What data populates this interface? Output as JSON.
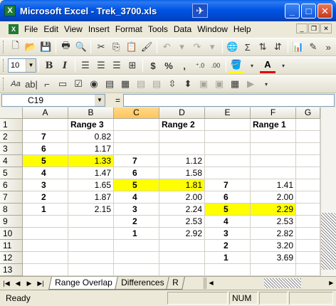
{
  "window": {
    "title": "Microsoft Excel - Trek_3700.xls",
    "app_icon": "X"
  },
  "menu": [
    "File",
    "Edit",
    "View",
    "Insert",
    "Format",
    "Tools",
    "Data",
    "Window",
    "Help"
  ],
  "toolbar": {
    "font_size": "10"
  },
  "formula_bar": {
    "name_box": "C19",
    "fx_label": "="
  },
  "grid": {
    "columns": [
      "A",
      "B",
      "C",
      "D",
      "E",
      "F",
      "G"
    ],
    "selected_column": "C",
    "rows": [
      {
        "n": "1",
        "cells": [
          "",
          "Range 3",
          "",
          "Range 2",
          "",
          "Range 1",
          ""
        ]
      },
      {
        "n": "2",
        "cells": [
          "7",
          "0.82",
          "",
          "",
          "",
          "",
          ""
        ]
      },
      {
        "n": "3",
        "cells": [
          "6",
          "1.17",
          "",
          "",
          "",
          "",
          ""
        ]
      },
      {
        "n": "4",
        "cells": [
          "5",
          "1.33",
          "7",
          "1.12",
          "",
          "",
          ""
        ]
      },
      {
        "n": "5",
        "cells": [
          "4",
          "1.47",
          "6",
          "1.58",
          "",
          "",
          ""
        ]
      },
      {
        "n": "6",
        "cells": [
          "3",
          "1.65",
          "5",
          "1.81",
          "7",
          "1.41",
          ""
        ]
      },
      {
        "n": "7",
        "cells": [
          "2",
          "1.87",
          "4",
          "2.00",
          "6",
          "2.00",
          ""
        ]
      },
      {
        "n": "8",
        "cells": [
          "1",
          "2.15",
          "3",
          "2.24",
          "5",
          "2.29",
          ""
        ]
      },
      {
        "n": "9",
        "cells": [
          "",
          "",
          "2",
          "2.53",
          "4",
          "2.53",
          ""
        ]
      },
      {
        "n": "10",
        "cells": [
          "",
          "",
          "1",
          "2.92",
          "3",
          "2.82",
          ""
        ]
      },
      {
        "n": "11",
        "cells": [
          "",
          "",
          "",
          "",
          "2",
          "3.20",
          ""
        ]
      },
      {
        "n": "12",
        "cells": [
          "",
          "",
          "",
          "",
          "1",
          "3.69",
          ""
        ]
      },
      {
        "n": "13",
        "cells": [
          "",
          "",
          "",
          "",
          "",
          "",
          ""
        ]
      }
    ],
    "highlight_color": "#ffff00"
  },
  "sheet_tabs": [
    "Range Overlap",
    "Differences",
    "R"
  ],
  "active_sheet": "Range Overlap",
  "status": {
    "text": "Ready",
    "num": "NUM"
  }
}
